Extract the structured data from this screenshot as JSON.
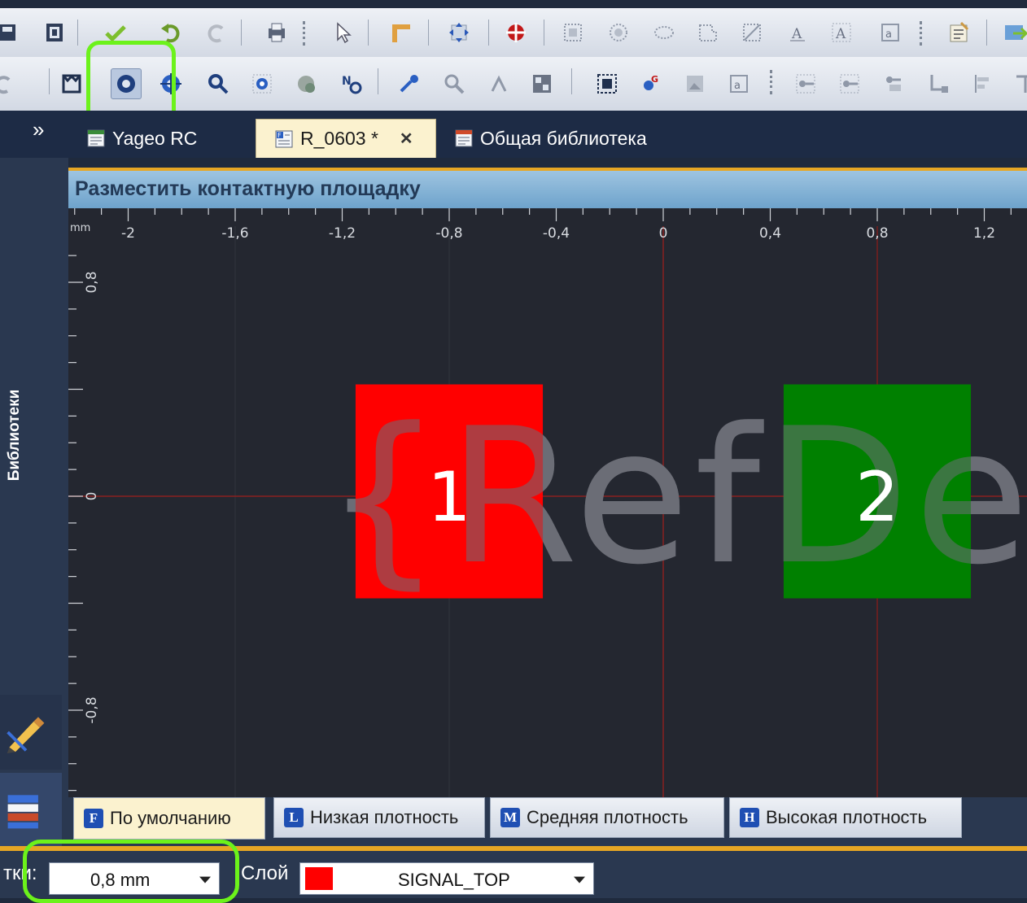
{
  "tabs": [
    {
      "label": "Yageo RC"
    },
    {
      "label": "R_0603 *",
      "close": "✕"
    },
    {
      "label": "Общая библиотека"
    }
  ],
  "sidebar": {
    "collapse": "»",
    "vertical_label": "Библиотеки"
  },
  "panel": {
    "title": "Разместить контактную площадку"
  },
  "canvas": {
    "unit": "mm",
    "x_ticks": [
      "-2",
      "-1,6",
      "-1,2",
      "-0,8",
      "-0,4",
      "0",
      "0,4",
      "0,8",
      "1,2"
    ],
    "y_ticks": [
      "0,8",
      "0",
      "-0,8"
    ],
    "watermark": "{RefDes}",
    "pads": [
      {
        "label": "1",
        "color": "#ff0000"
      },
      {
        "label": "2",
        "color": "#008000"
      }
    ]
  },
  "density_tabs": [
    {
      "badge": "F",
      "label": "По умолчанию"
    },
    {
      "badge": "L",
      "label": "Низкая плотность"
    },
    {
      "badge": "M",
      "label": "Средняя плотность"
    },
    {
      "badge": "H",
      "label": "Высокая плотность"
    }
  ],
  "statusbar": {
    "grid_label": "тки:",
    "grid_value": "0,8 mm",
    "layer_label": "Слой",
    "layer_value": "SIGNAL_TOP",
    "layer_color": "#ff0000"
  },
  "colors": {
    "accent": "#e6a624",
    "highlight": "#6cf21b",
    "canvas": "#242730"
  }
}
